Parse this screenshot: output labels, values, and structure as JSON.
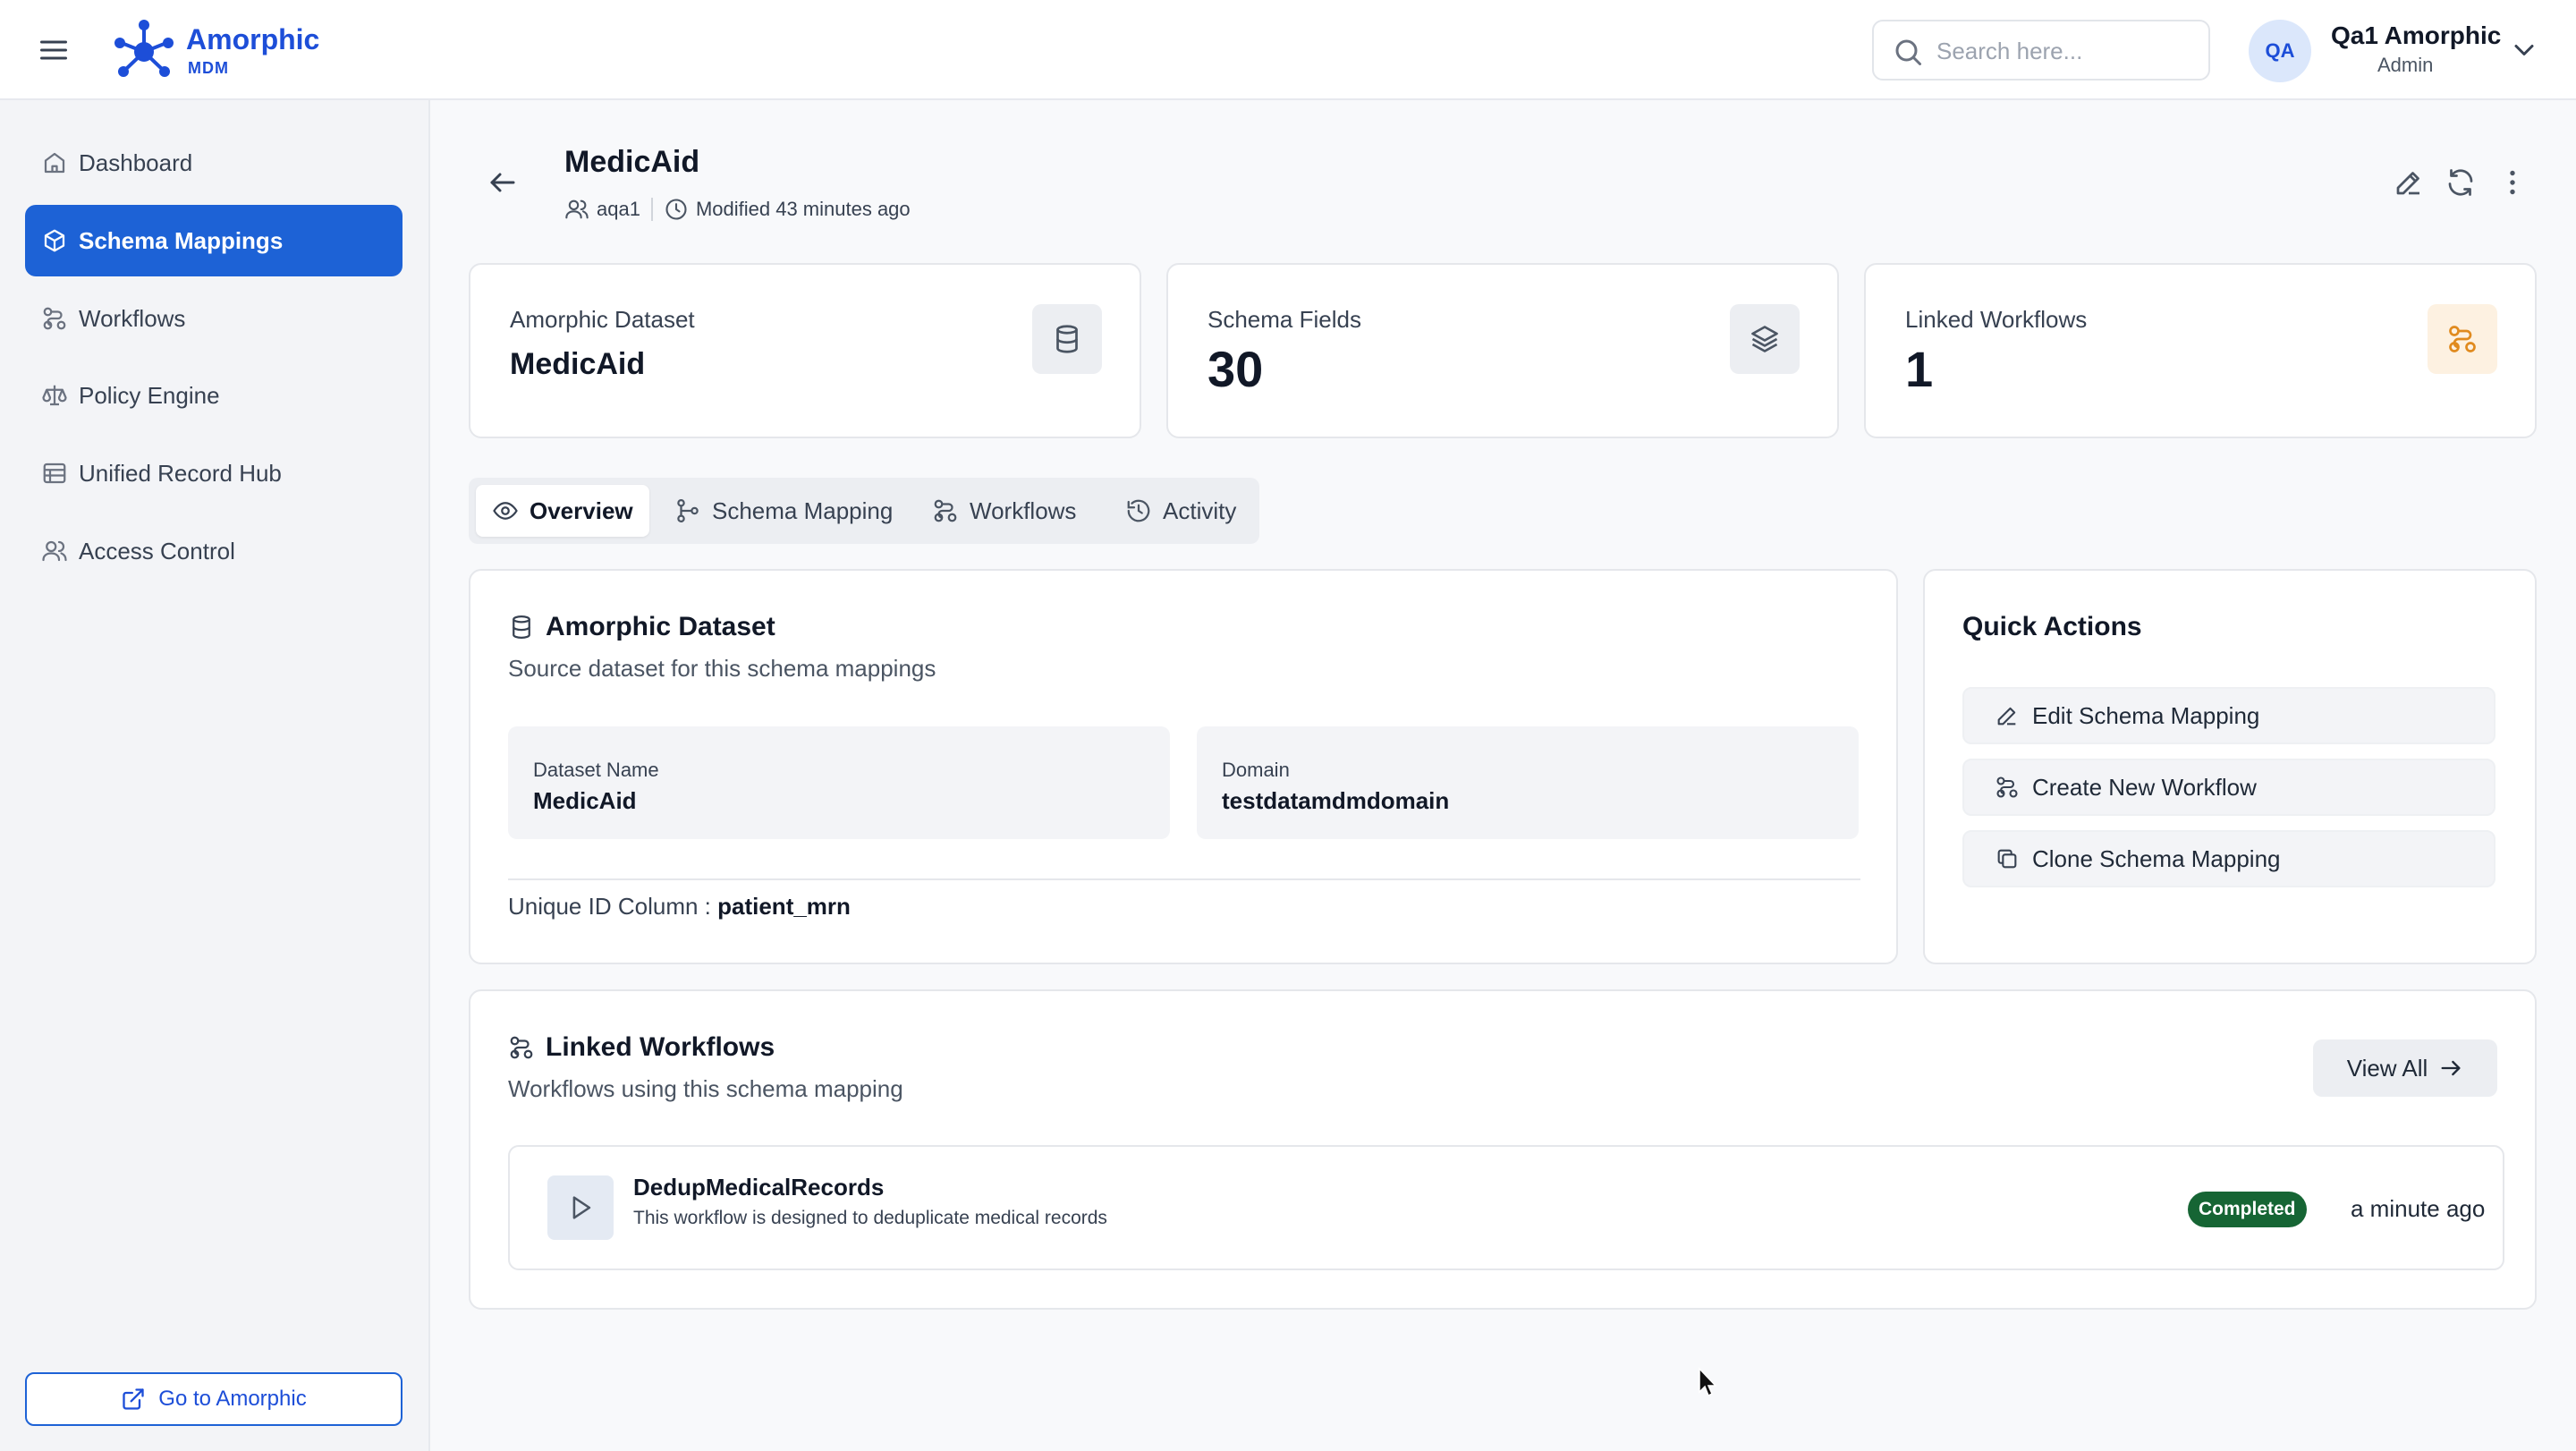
{
  "app": {
    "brand": "Amorphic",
    "brand_sub": "MDM"
  },
  "search": {
    "placeholder": "Search here..."
  },
  "user": {
    "initials": "QA",
    "name": "Qa1 Amorphic",
    "role": "Admin"
  },
  "sidebar": {
    "items": [
      {
        "label": "Dashboard",
        "icon": "home-icon",
        "active": false
      },
      {
        "label": "Schema Mappings",
        "icon": "cube-icon",
        "active": true
      },
      {
        "label": "Workflows",
        "icon": "workflow-icon",
        "active": false
      },
      {
        "label": "Policy Engine",
        "icon": "scale-icon",
        "active": false
      },
      {
        "label": "Unified Record Hub",
        "icon": "database-table-icon",
        "active": false
      },
      {
        "label": "Access Control",
        "icon": "users-icon",
        "active": false
      }
    ],
    "footer_button": "Go to Amorphic"
  },
  "page": {
    "title": "MedicAid",
    "owner": "aqa1",
    "modified": "Modified 43 minutes ago"
  },
  "stats": [
    {
      "label": "Amorphic Dataset",
      "value": "MedicAid",
      "icon": "database-icon"
    },
    {
      "label": "Schema Fields",
      "value": "30",
      "icon": "layers-icon"
    },
    {
      "label": "Linked Workflows",
      "value": "1",
      "icon": "workflow-icon"
    }
  ],
  "tabs": [
    {
      "label": "Overview",
      "active": true
    },
    {
      "label": "Schema Mapping",
      "active": false
    },
    {
      "label": "Workflows",
      "active": false
    },
    {
      "label": "Activity",
      "active": false
    }
  ],
  "dataset_card": {
    "title": "Amorphic Dataset",
    "subtitle": "Source dataset for this schema mappings",
    "fields": [
      {
        "label": "Dataset Name",
        "value": "MedicAid"
      },
      {
        "label": "Domain",
        "value": "testdatamdmdomain"
      }
    ],
    "unique_id_label": "Unique ID Column :",
    "unique_id_value": "patient_mrn"
  },
  "quick_actions": {
    "title": "Quick Actions",
    "items": [
      {
        "label": "Edit Schema Mapping",
        "icon": "pencil-icon"
      },
      {
        "label": "Create New Workflow",
        "icon": "workflow-icon"
      },
      {
        "label": "Clone Schema Mapping",
        "icon": "copy-icon"
      }
    ]
  },
  "linked_workflows": {
    "title": "Linked Workflows",
    "subtitle": "Workflows using this schema mapping",
    "view_all": "View All",
    "rows": [
      {
        "name": "DedupMedicalRecords",
        "description": "This workflow is designed to deduplicate medical records",
        "status": "Completed",
        "time": "a minute ago"
      }
    ]
  },
  "colors": {
    "accent": "#1d62d6",
    "status_completed": "#166534",
    "workflow_icon_accent": "#e08a1e"
  }
}
